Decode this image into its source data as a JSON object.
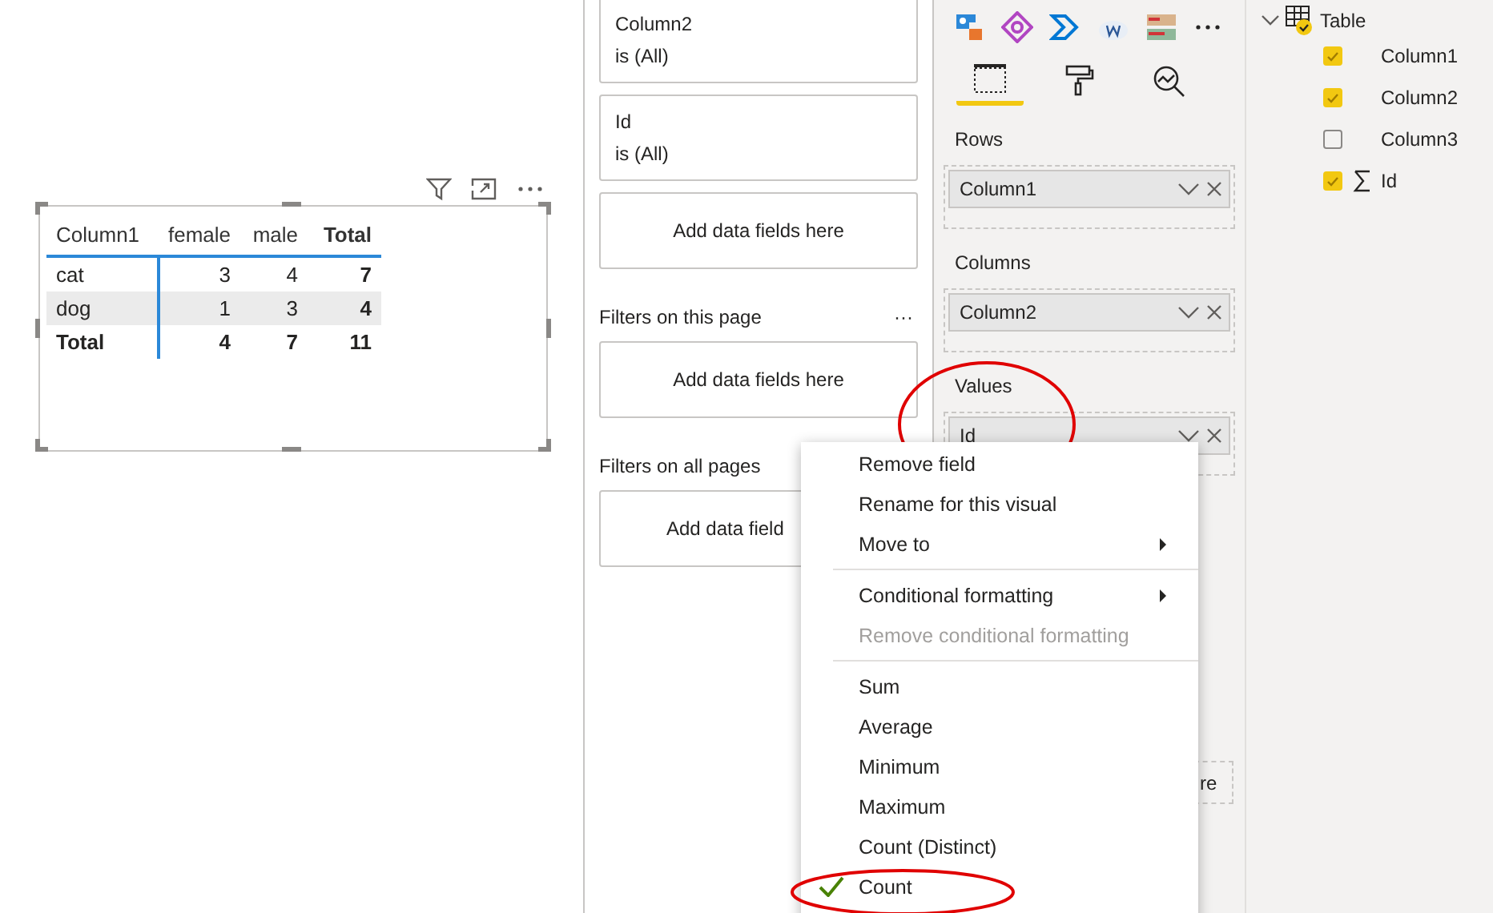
{
  "matrix": {
    "columns": [
      "Column1",
      "female",
      "male",
      "Total"
    ],
    "rows": [
      {
        "cells": [
          "cat",
          "3",
          "4",
          "7"
        ],
        "shaded": false,
        "total": false
      },
      {
        "cells": [
          "dog",
          "1",
          "3",
          "4"
        ],
        "shaded": true,
        "total": false
      },
      {
        "cells": [
          "Total",
          "4",
          "7",
          "11"
        ],
        "shaded": false,
        "total": true
      }
    ]
  },
  "filters": {
    "visual_cards": [
      {
        "kind": "filter",
        "field": "Column2",
        "condition": "is (All)"
      },
      {
        "kind": "filter",
        "field": "Id",
        "condition": "is (All)"
      },
      {
        "kind": "drop",
        "text": "Add data fields here"
      }
    ],
    "sections": [
      {
        "title": "Filters on this page",
        "more": "···",
        "drop": "Add data fields here"
      },
      {
        "title": "Filters on all pages",
        "drop": "Add data field"
      }
    ]
  },
  "visualizations": {
    "tabs": [
      {
        "kind": "fields",
        "selected": true
      },
      {
        "kind": "format",
        "selected": false
      },
      {
        "kind": "analytics",
        "selected": false
      }
    ],
    "wells": [
      {
        "label": "Rows",
        "field": "Column1",
        "highlighted": false
      },
      {
        "label": "Columns",
        "field": "Column2",
        "highlighted": false
      },
      {
        "label": "Values",
        "field": "Id",
        "highlighted": true
      }
    ],
    "hidden_well_text": "re"
  },
  "fields": {
    "tables": [
      {
        "name": "Table",
        "expanded": true,
        "checked": true,
        "children": [
          {
            "name": "Column1",
            "checked": true,
            "kind": "text"
          },
          {
            "name": "Column2",
            "checked": true,
            "kind": "text"
          },
          {
            "name": "Column3",
            "checked": false,
            "kind": "text"
          },
          {
            "name": "Id",
            "checked": true,
            "kind": "numeric"
          }
        ]
      }
    ]
  },
  "context_menu": [
    {
      "kind": "item",
      "label": "Remove field",
      "disabled": false,
      "checked": false,
      "submenu": false,
      "highlighted": false
    },
    {
      "kind": "item",
      "label": "Rename for this visual",
      "disabled": false,
      "checked": false,
      "submenu": false,
      "highlighted": false
    },
    {
      "kind": "item",
      "label": "Move to",
      "disabled": false,
      "checked": false,
      "submenu": true,
      "highlighted": false
    },
    {
      "kind": "separator"
    },
    {
      "kind": "item",
      "label": "Conditional formatting",
      "disabled": false,
      "checked": false,
      "submenu": true,
      "highlighted": false
    },
    {
      "kind": "item",
      "label": "Remove conditional formatting",
      "disabled": true,
      "checked": false,
      "submenu": false,
      "highlighted": false
    },
    {
      "kind": "separator"
    },
    {
      "kind": "item",
      "label": "Sum",
      "disabled": false,
      "checked": false,
      "submenu": false,
      "highlighted": false
    },
    {
      "kind": "item",
      "label": "Average",
      "disabled": false,
      "checked": false,
      "submenu": false,
      "highlighted": false
    },
    {
      "kind": "item",
      "label": "Minimum",
      "disabled": false,
      "checked": false,
      "submenu": false,
      "highlighted": false
    },
    {
      "kind": "item",
      "label": "Maximum",
      "disabled": false,
      "checked": false,
      "submenu": false,
      "highlighted": false
    },
    {
      "kind": "item",
      "label": "Count (Distinct)",
      "disabled": false,
      "checked": false,
      "submenu": false,
      "highlighted": false
    },
    {
      "kind": "item",
      "label": "Count",
      "disabled": false,
      "checked": true,
      "submenu": false,
      "highlighted": true
    }
  ]
}
